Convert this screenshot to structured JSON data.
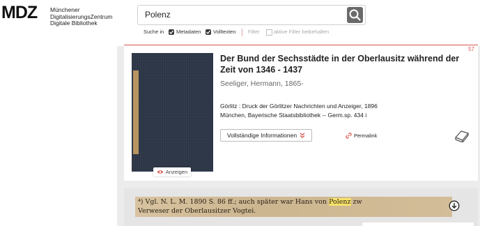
{
  "header": {
    "logo": {
      "mark": "MDZ",
      "lines": [
        "Münchener",
        "DigitalisierungsZentrum",
        "Digitale Bibliothek"
      ]
    },
    "search": {
      "value": "Polenz",
      "icon": "search-icon"
    },
    "filters": {
      "search_in_label": "Suche in",
      "metadata_label": "Metadaten",
      "metadata_checked": true,
      "fulltext_label": "Volltexten",
      "fulltext_checked": true,
      "filter_label": "Filter",
      "keep_filter_label": "aktive Filter beibehalten",
      "keep_filter_checked": false
    }
  },
  "result": {
    "hit_number": "57",
    "title": "Der Bund der Sechsstädte in der Oberlausitz während der Zeit von 1346 - 1437",
    "author": "Seeliger, Hermann, 1865-",
    "publisher": "Görlitz : Druck der Görlitzer Nachrichten und Anzeiger, 1896",
    "holding": "München, Bayerische Staatsbibliothek -- Germ.sp. 434 i",
    "show_label": "Anzeigen",
    "info_label": "Vollständige Informationen",
    "permalink_label": "Permalink",
    "icons": {
      "show": "eye-icon",
      "info": "chevron-down-icon",
      "permalink": "link-icon",
      "book": "book-icon"
    }
  },
  "fulltext": {
    "line1_before": "⁴) Vgl. N. L. M. 1890 S. 86 ff.; auch später war Hans von ",
    "line1_highlight": "Polenz",
    "line1_after": " zw",
    "line2": "Verweser der Oberlausitzer Vogtei.",
    "icon": "download-icon"
  },
  "colors": {
    "accent": "#d9534f",
    "highlight": "#f5e26a"
  }
}
